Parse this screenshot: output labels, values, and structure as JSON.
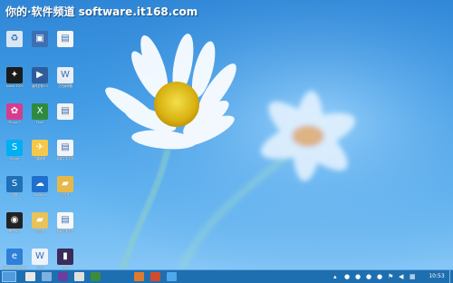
{
  "watermark": "你的·软件频道 software.it168.com",
  "desktop": {
    "icons": [
      {
        "label": "",
        "icon": "recycle-bin-icon",
        "color": "#d9e7f5"
      },
      {
        "label": "",
        "icon": "app-icon",
        "color": "#3d6fb3"
      },
      {
        "label": "",
        "icon": "document-icon",
        "color": "#f4f4f4"
      },
      {
        "label": "Adobe 2000",
        "icon": "fox-icon",
        "color": "#1b1b1b"
      },
      {
        "label": "暴风影音5.0",
        "icon": "media-player-icon",
        "color": "#2f5d9b"
      },
      {
        "label": "文档编辑器",
        "icon": "word-icon",
        "color": "#e9eef6"
      },
      {
        "label": "Picasa 3",
        "icon": "picasa-icon",
        "color": "#d43f8d"
      },
      {
        "label": "Excel",
        "icon": "excel-icon",
        "color": "#2e8b3e"
      },
      {
        "label": "",
        "icon": "text-file-icon",
        "color": "#f2f2f2"
      },
      {
        "label": "Skype",
        "icon": "skype-icon",
        "color": "#00aff0"
      },
      {
        "label": "迅雷看看",
        "icon": "bird-icon",
        "color": "#f5c84a"
      },
      {
        "label": "新建文本文档",
        "icon": "document-icon",
        "color": "#f4f4f4"
      },
      {
        "label": "迅雷",
        "icon": "thunder-icon",
        "color": "#1e70b8"
      },
      {
        "label": "SkyDrive",
        "icon": "cloud-icon",
        "color": "#1f6fcf"
      },
      {
        "label": "文件夹",
        "icon": "folder-icon",
        "color": "#e6b84a"
      },
      {
        "label": "腾讯QQ",
        "icon": "qq-icon",
        "color": "#222222"
      },
      {
        "label": "文件夹",
        "icon": "folder-icon",
        "color": "#e8c25a"
      },
      {
        "label": "新建文本文档",
        "icon": "text-file-icon",
        "color": "#f7f7f7"
      },
      {
        "label": "Internet Explorer",
        "icon": "ie-icon",
        "color": "#2d7fd8"
      },
      {
        "label": "文档",
        "icon": "word-icon",
        "color": "#eef3fa"
      },
      {
        "label": "视频",
        "icon": "video-icon",
        "color": "#3a2b5a"
      }
    ]
  },
  "taskbar": {
    "clock": "10:53",
    "tasks": [
      {
        "name": "taskbar-app-1",
        "color": "#e8e8e8"
      },
      {
        "name": "taskbar-app-2",
        "color": "#7fb0e0"
      },
      {
        "name": "taskbar-app-3",
        "color": "#6a3fa0"
      },
      {
        "name": "taskbar-app-4",
        "color": "#e0e0e0"
      },
      {
        "name": "taskbar-app-5",
        "color": "#3d8b3d"
      },
      {
        "name": "taskbar-app-6",
        "color": "#e07a2d"
      },
      {
        "name": "taskbar-app-7",
        "color": "#d44b2b"
      },
      {
        "name": "taskbar-app-8",
        "color": "#4fa8ea"
      }
    ]
  }
}
